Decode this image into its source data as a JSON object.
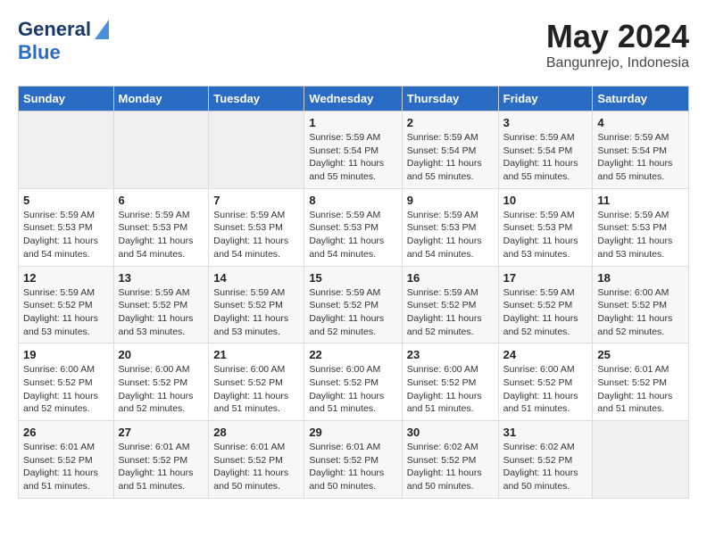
{
  "header": {
    "logo_general": "General",
    "logo_blue": "Blue",
    "title": "May 2024",
    "subtitle": "Bangunrejo, Indonesia"
  },
  "weekdays": [
    "Sunday",
    "Monday",
    "Tuesday",
    "Wednesday",
    "Thursday",
    "Friday",
    "Saturday"
  ],
  "weeks": [
    {
      "days": [
        {
          "num": "",
          "info": ""
        },
        {
          "num": "",
          "info": ""
        },
        {
          "num": "",
          "info": ""
        },
        {
          "num": "1",
          "info": "Sunrise: 5:59 AM\nSunset: 5:54 PM\nDaylight: 11 hours\nand 55 minutes."
        },
        {
          "num": "2",
          "info": "Sunrise: 5:59 AM\nSunset: 5:54 PM\nDaylight: 11 hours\nand 55 minutes."
        },
        {
          "num": "3",
          "info": "Sunrise: 5:59 AM\nSunset: 5:54 PM\nDaylight: 11 hours\nand 55 minutes."
        },
        {
          "num": "4",
          "info": "Sunrise: 5:59 AM\nSunset: 5:54 PM\nDaylight: 11 hours\nand 55 minutes."
        }
      ]
    },
    {
      "days": [
        {
          "num": "5",
          "info": "Sunrise: 5:59 AM\nSunset: 5:53 PM\nDaylight: 11 hours\nand 54 minutes."
        },
        {
          "num": "6",
          "info": "Sunrise: 5:59 AM\nSunset: 5:53 PM\nDaylight: 11 hours\nand 54 minutes."
        },
        {
          "num": "7",
          "info": "Sunrise: 5:59 AM\nSunset: 5:53 PM\nDaylight: 11 hours\nand 54 minutes."
        },
        {
          "num": "8",
          "info": "Sunrise: 5:59 AM\nSunset: 5:53 PM\nDaylight: 11 hours\nand 54 minutes."
        },
        {
          "num": "9",
          "info": "Sunrise: 5:59 AM\nSunset: 5:53 PM\nDaylight: 11 hours\nand 54 minutes."
        },
        {
          "num": "10",
          "info": "Sunrise: 5:59 AM\nSunset: 5:53 PM\nDaylight: 11 hours\nand 53 minutes."
        },
        {
          "num": "11",
          "info": "Sunrise: 5:59 AM\nSunset: 5:53 PM\nDaylight: 11 hours\nand 53 minutes."
        }
      ]
    },
    {
      "days": [
        {
          "num": "12",
          "info": "Sunrise: 5:59 AM\nSunset: 5:52 PM\nDaylight: 11 hours\nand 53 minutes."
        },
        {
          "num": "13",
          "info": "Sunrise: 5:59 AM\nSunset: 5:52 PM\nDaylight: 11 hours\nand 53 minutes."
        },
        {
          "num": "14",
          "info": "Sunrise: 5:59 AM\nSunset: 5:52 PM\nDaylight: 11 hours\nand 53 minutes."
        },
        {
          "num": "15",
          "info": "Sunrise: 5:59 AM\nSunset: 5:52 PM\nDaylight: 11 hours\nand 52 minutes."
        },
        {
          "num": "16",
          "info": "Sunrise: 5:59 AM\nSunset: 5:52 PM\nDaylight: 11 hours\nand 52 minutes."
        },
        {
          "num": "17",
          "info": "Sunrise: 5:59 AM\nSunset: 5:52 PM\nDaylight: 11 hours\nand 52 minutes."
        },
        {
          "num": "18",
          "info": "Sunrise: 6:00 AM\nSunset: 5:52 PM\nDaylight: 11 hours\nand 52 minutes."
        }
      ]
    },
    {
      "days": [
        {
          "num": "19",
          "info": "Sunrise: 6:00 AM\nSunset: 5:52 PM\nDaylight: 11 hours\nand 52 minutes."
        },
        {
          "num": "20",
          "info": "Sunrise: 6:00 AM\nSunset: 5:52 PM\nDaylight: 11 hours\nand 52 minutes."
        },
        {
          "num": "21",
          "info": "Sunrise: 6:00 AM\nSunset: 5:52 PM\nDaylight: 11 hours\nand 51 minutes."
        },
        {
          "num": "22",
          "info": "Sunrise: 6:00 AM\nSunset: 5:52 PM\nDaylight: 11 hours\nand 51 minutes."
        },
        {
          "num": "23",
          "info": "Sunrise: 6:00 AM\nSunset: 5:52 PM\nDaylight: 11 hours\nand 51 minutes."
        },
        {
          "num": "24",
          "info": "Sunrise: 6:00 AM\nSunset: 5:52 PM\nDaylight: 11 hours\nand 51 minutes."
        },
        {
          "num": "25",
          "info": "Sunrise: 6:01 AM\nSunset: 5:52 PM\nDaylight: 11 hours\nand 51 minutes."
        }
      ]
    },
    {
      "days": [
        {
          "num": "26",
          "info": "Sunrise: 6:01 AM\nSunset: 5:52 PM\nDaylight: 11 hours\nand 51 minutes."
        },
        {
          "num": "27",
          "info": "Sunrise: 6:01 AM\nSunset: 5:52 PM\nDaylight: 11 hours\nand 51 minutes."
        },
        {
          "num": "28",
          "info": "Sunrise: 6:01 AM\nSunset: 5:52 PM\nDaylight: 11 hours\nand 50 minutes."
        },
        {
          "num": "29",
          "info": "Sunrise: 6:01 AM\nSunset: 5:52 PM\nDaylight: 11 hours\nand 50 minutes."
        },
        {
          "num": "30",
          "info": "Sunrise: 6:02 AM\nSunset: 5:52 PM\nDaylight: 11 hours\nand 50 minutes."
        },
        {
          "num": "31",
          "info": "Sunrise: 6:02 AM\nSunset: 5:52 PM\nDaylight: 11 hours\nand 50 minutes."
        },
        {
          "num": "",
          "info": ""
        }
      ]
    }
  ]
}
